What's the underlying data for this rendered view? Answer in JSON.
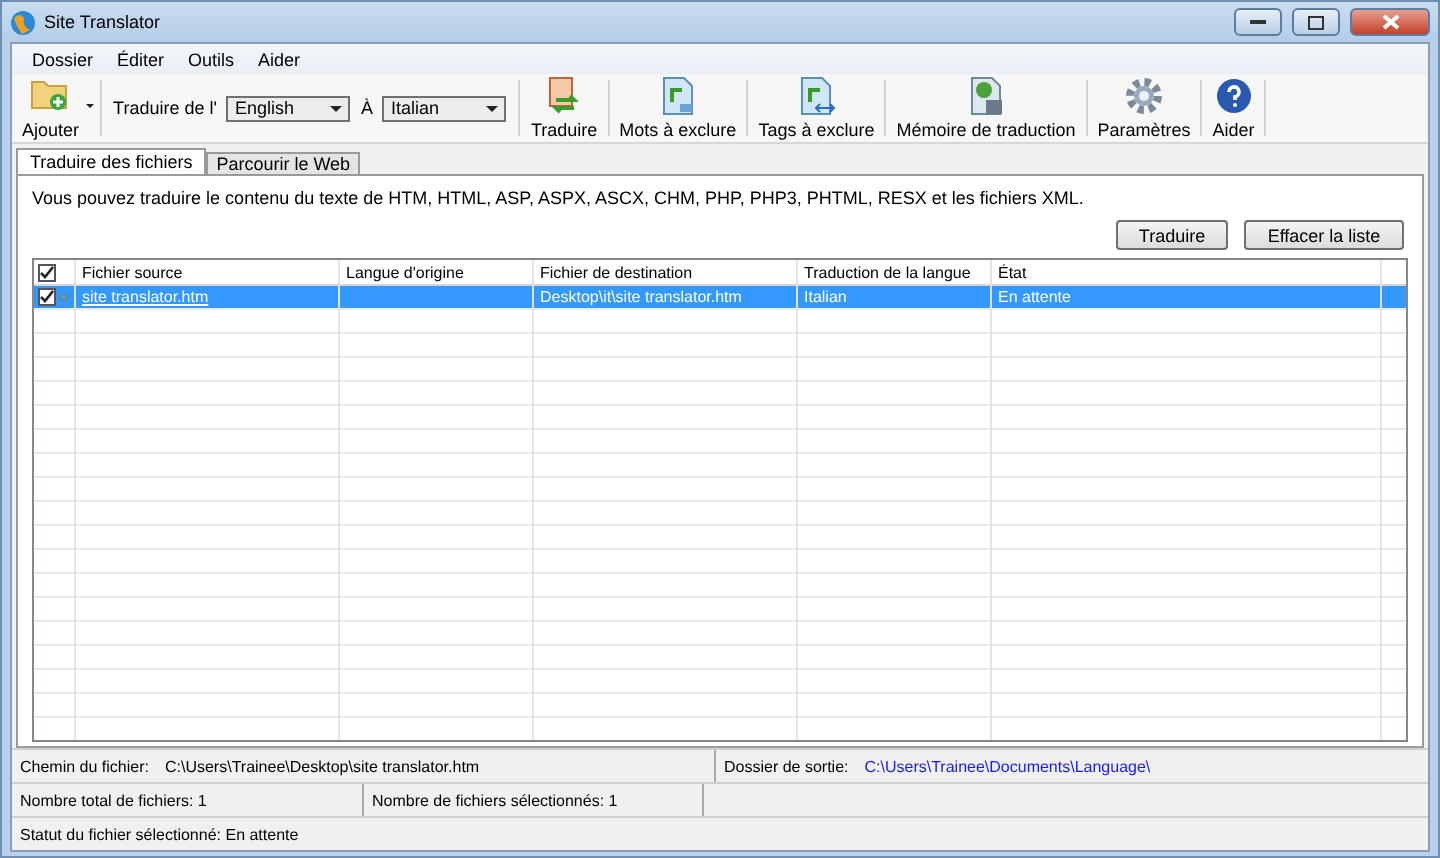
{
  "window": {
    "title": "Site Translator"
  },
  "menu": [
    "Dossier",
    "Éditer",
    "Outils",
    "Aider"
  ],
  "toolbar": {
    "add_label": "Ajouter",
    "from_label": "Traduire de l'",
    "from_language": "English",
    "to_label": "À",
    "to_language": "Italian",
    "buttons": [
      {
        "label": "Traduire",
        "kind": "translate"
      },
      {
        "label": "Mots à exclure",
        "kind": "words"
      },
      {
        "label": "Tags à exclure",
        "kind": "tags"
      },
      {
        "label": "Mémoire de traduction",
        "kind": "memory"
      },
      {
        "label": "Paramètres",
        "kind": "settings"
      },
      {
        "label": "Aider",
        "kind": "help"
      }
    ]
  },
  "tabs": [
    {
      "label": "Traduire des fichiers",
      "selected": true
    },
    {
      "label": "Parcourir le Web",
      "selected": false
    }
  ],
  "description": "Vous pouvez traduire le contenu du texte de HTM, HTML, ASP, ASPX, ASCX, CHM, PHP, PHP3, PHTML, RESX et les fichiers XML.",
  "actions": [
    "Traduire",
    "Effacer la liste"
  ],
  "table": {
    "header_checked": true,
    "columns": [
      "Fichier source",
      "Langue d'origine",
      "Fichier de destination",
      "Traduction de la langue",
      "État"
    ],
    "rows": [
      {
        "checked": true,
        "selected": true,
        "cells": [
          "site translator.htm",
          "",
          "Desktop\\it\\site translator.htm",
          "Italian",
          "En attente"
        ]
      }
    ]
  },
  "status": {
    "file_path_label": "Chemin du fichier:",
    "file_path": "C:\\Users\\Trainee\\Desktop\\site translator.htm",
    "output_label": "Dossier de sortie:",
    "output_folder": "C:\\Users\\Trainee\\Documents\\Language\\",
    "total": "Nombre total de fichiers: 1",
    "selected_count": "Nombre de fichiers sélectionnés: 1",
    "file_status": "Statut du fichier sélectionné: En attente"
  }
}
